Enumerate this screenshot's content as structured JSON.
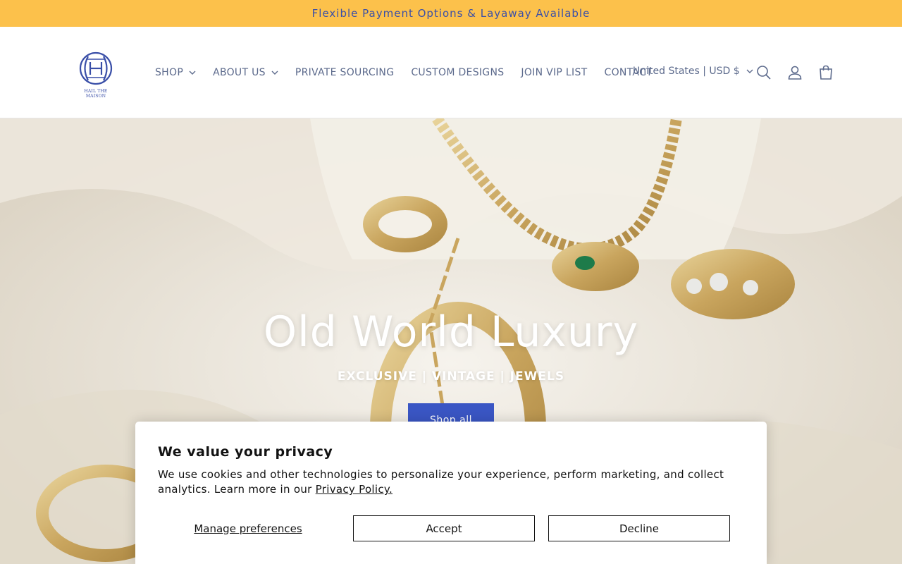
{
  "announcement": {
    "text": "Flexible Payment Options & Layaway Available"
  },
  "header": {
    "logo_text": "HAIL THE MAISON",
    "nav": [
      {
        "label": "SHOP",
        "has_dropdown": true
      },
      {
        "label": "ABOUT US",
        "has_dropdown": true
      },
      {
        "label": "PRIVATE SOURCING",
        "has_dropdown": false
      },
      {
        "label": "CUSTOM DESIGNS",
        "has_dropdown": false
      },
      {
        "label": "JOIN VIP LIST",
        "has_dropdown": false
      },
      {
        "label": "CONTACT",
        "has_dropdown": false
      }
    ],
    "country_selector": "United States | USD $",
    "icons": [
      "search-icon",
      "account-icon",
      "cart-icon"
    ]
  },
  "hero": {
    "title": "Old World Luxury",
    "subtitle": "EXCLUSIVE | VINTAGE | JEWELS",
    "button_label": "Shop all"
  },
  "cookie_banner": {
    "title": "We value your privacy",
    "text": "We use cookies and other technologies to personalize your experience, perform marketing, and collect analytics. Learn more in our ",
    "link_text": "Privacy Policy.",
    "manage_label": "Manage preferences",
    "accept_label": "Accept",
    "decline_label": "Decline"
  },
  "colors": {
    "announcement_bg": "#fcc14b",
    "brand_blue": "#3a4fa8",
    "button_blue": "#3a56c4",
    "nav_text": "#5c6a8c"
  }
}
